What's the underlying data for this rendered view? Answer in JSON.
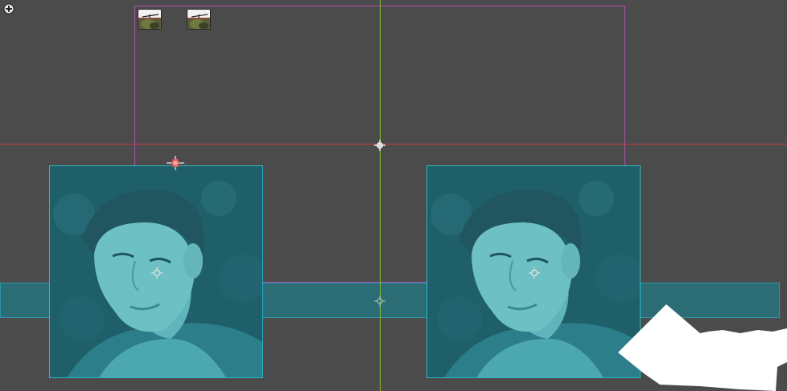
{
  "canvas": {
    "background": "#4b4b4b",
    "guide_colors": {
      "horizontal": "#c23a40",
      "vertical": "#8fbf2a",
      "frame": "#b14fb2",
      "band": "#2c6c75",
      "photo_border": "#2ab7c8"
    }
  },
  "toolbar": {
    "add_icon": "plus-circle-icon"
  },
  "thumbnails": [
    {
      "icon": "image-thumbnail-icon"
    },
    {
      "icon": "image-thumbnail-icon"
    }
  ],
  "photos": [
    {
      "name": "portrait-sprite-left",
      "tint": "#2ab7c8"
    },
    {
      "name": "portrait-sprite-right",
      "tint": "#2ab7c8"
    }
  ],
  "handles": {
    "pivot_icon": "crosshair-icon",
    "anchor_icon": "anchor-pin-icon"
  }
}
